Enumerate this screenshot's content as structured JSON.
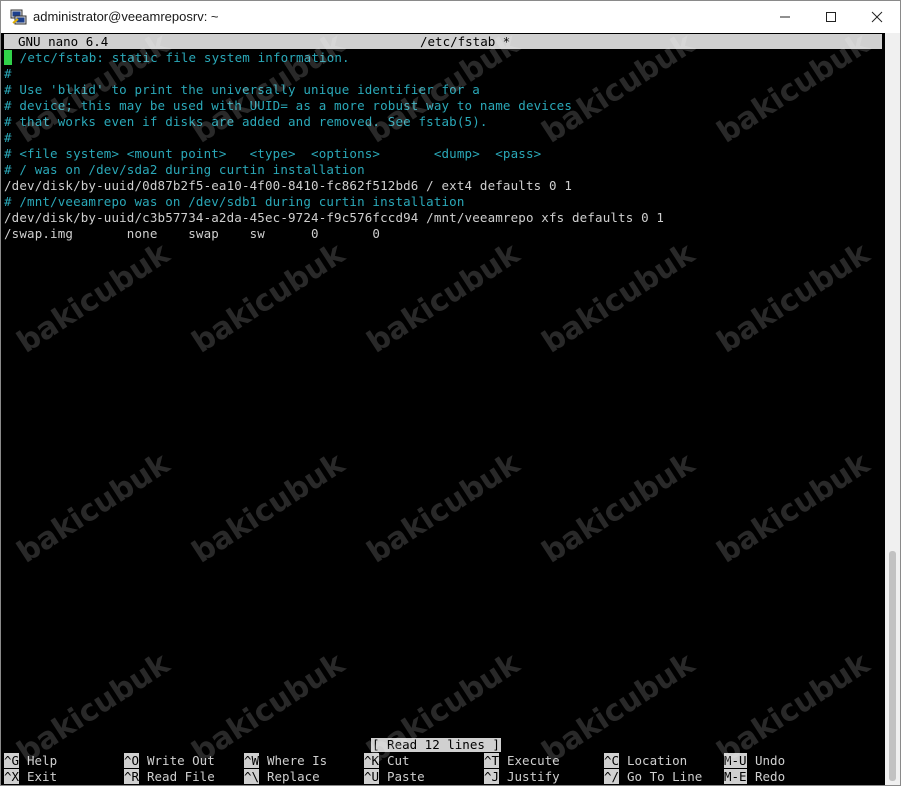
{
  "window": {
    "title": "administrator@veeamreposrv: ~"
  },
  "nano": {
    "program": "GNU nano 6.4",
    "filename": "/etc/fstab *",
    "lines": [
      {
        "text": " /etc/fstab: static file system information.",
        "comment": true
      },
      {
        "text": "#",
        "comment": true
      },
      {
        "text": "# Use 'blkid' to print the universally unique identifier for a",
        "comment": true
      },
      {
        "text": "# device; this may be used with UUID= as a more robust way to name devices",
        "comment": true
      },
      {
        "text": "# that works even if disks are added and removed. See fstab(5).",
        "comment": true
      },
      {
        "text": "#",
        "comment": true
      },
      {
        "text": "# <file system> <mount point>   <type>  <options>       <dump>  <pass>",
        "comment": true
      },
      {
        "text": "# / was on /dev/sda2 during curtin installation",
        "comment": true
      },
      {
        "text": "/dev/disk/by-uuid/0d87b2f5-ea10-4f00-8410-fc862f512bd6 / ext4 defaults 0 1",
        "comment": false
      },
      {
        "text": "# /mnt/veeamrepo was on /dev/sdb1 during curtin installation",
        "comment": true
      },
      {
        "text": "/dev/disk/by-uuid/c3b57734-a2da-45ec-9724-f9c576fccd94 /mnt/veeamrepo xfs defaults 0 1",
        "comment": false
      },
      {
        "text": "/swap.img       none    swap    sw      0       0",
        "comment": false
      }
    ],
    "status_message": "[ Read 12 lines ]",
    "shortcuts_row1": [
      {
        "key": "^G",
        "label": "Help"
      },
      {
        "key": "^O",
        "label": "Write Out"
      },
      {
        "key": "^W",
        "label": "Where Is"
      },
      {
        "key": "^K",
        "label": "Cut"
      },
      {
        "key": "^T",
        "label": "Execute"
      },
      {
        "key": "^C",
        "label": "Location"
      },
      {
        "key": "M-U",
        "label": "Undo"
      }
    ],
    "shortcuts_row2": [
      {
        "key": "^X",
        "label": "Exit"
      },
      {
        "key": "^R",
        "label": "Read File"
      },
      {
        "key": "^\\",
        "label": "Replace"
      },
      {
        "key": "^U",
        "label": "Paste"
      },
      {
        "key": "^J",
        "label": "Justify"
      },
      {
        "key": "^/",
        "label": "Go To Line"
      },
      {
        "key": "M-E",
        "label": "Redo"
      }
    ]
  },
  "watermark": "bakicubuk",
  "colors": {
    "comment": "#2aa8b8",
    "cursor": "#31d24a",
    "bar": "#d0d0d0",
    "background": "#000000"
  }
}
